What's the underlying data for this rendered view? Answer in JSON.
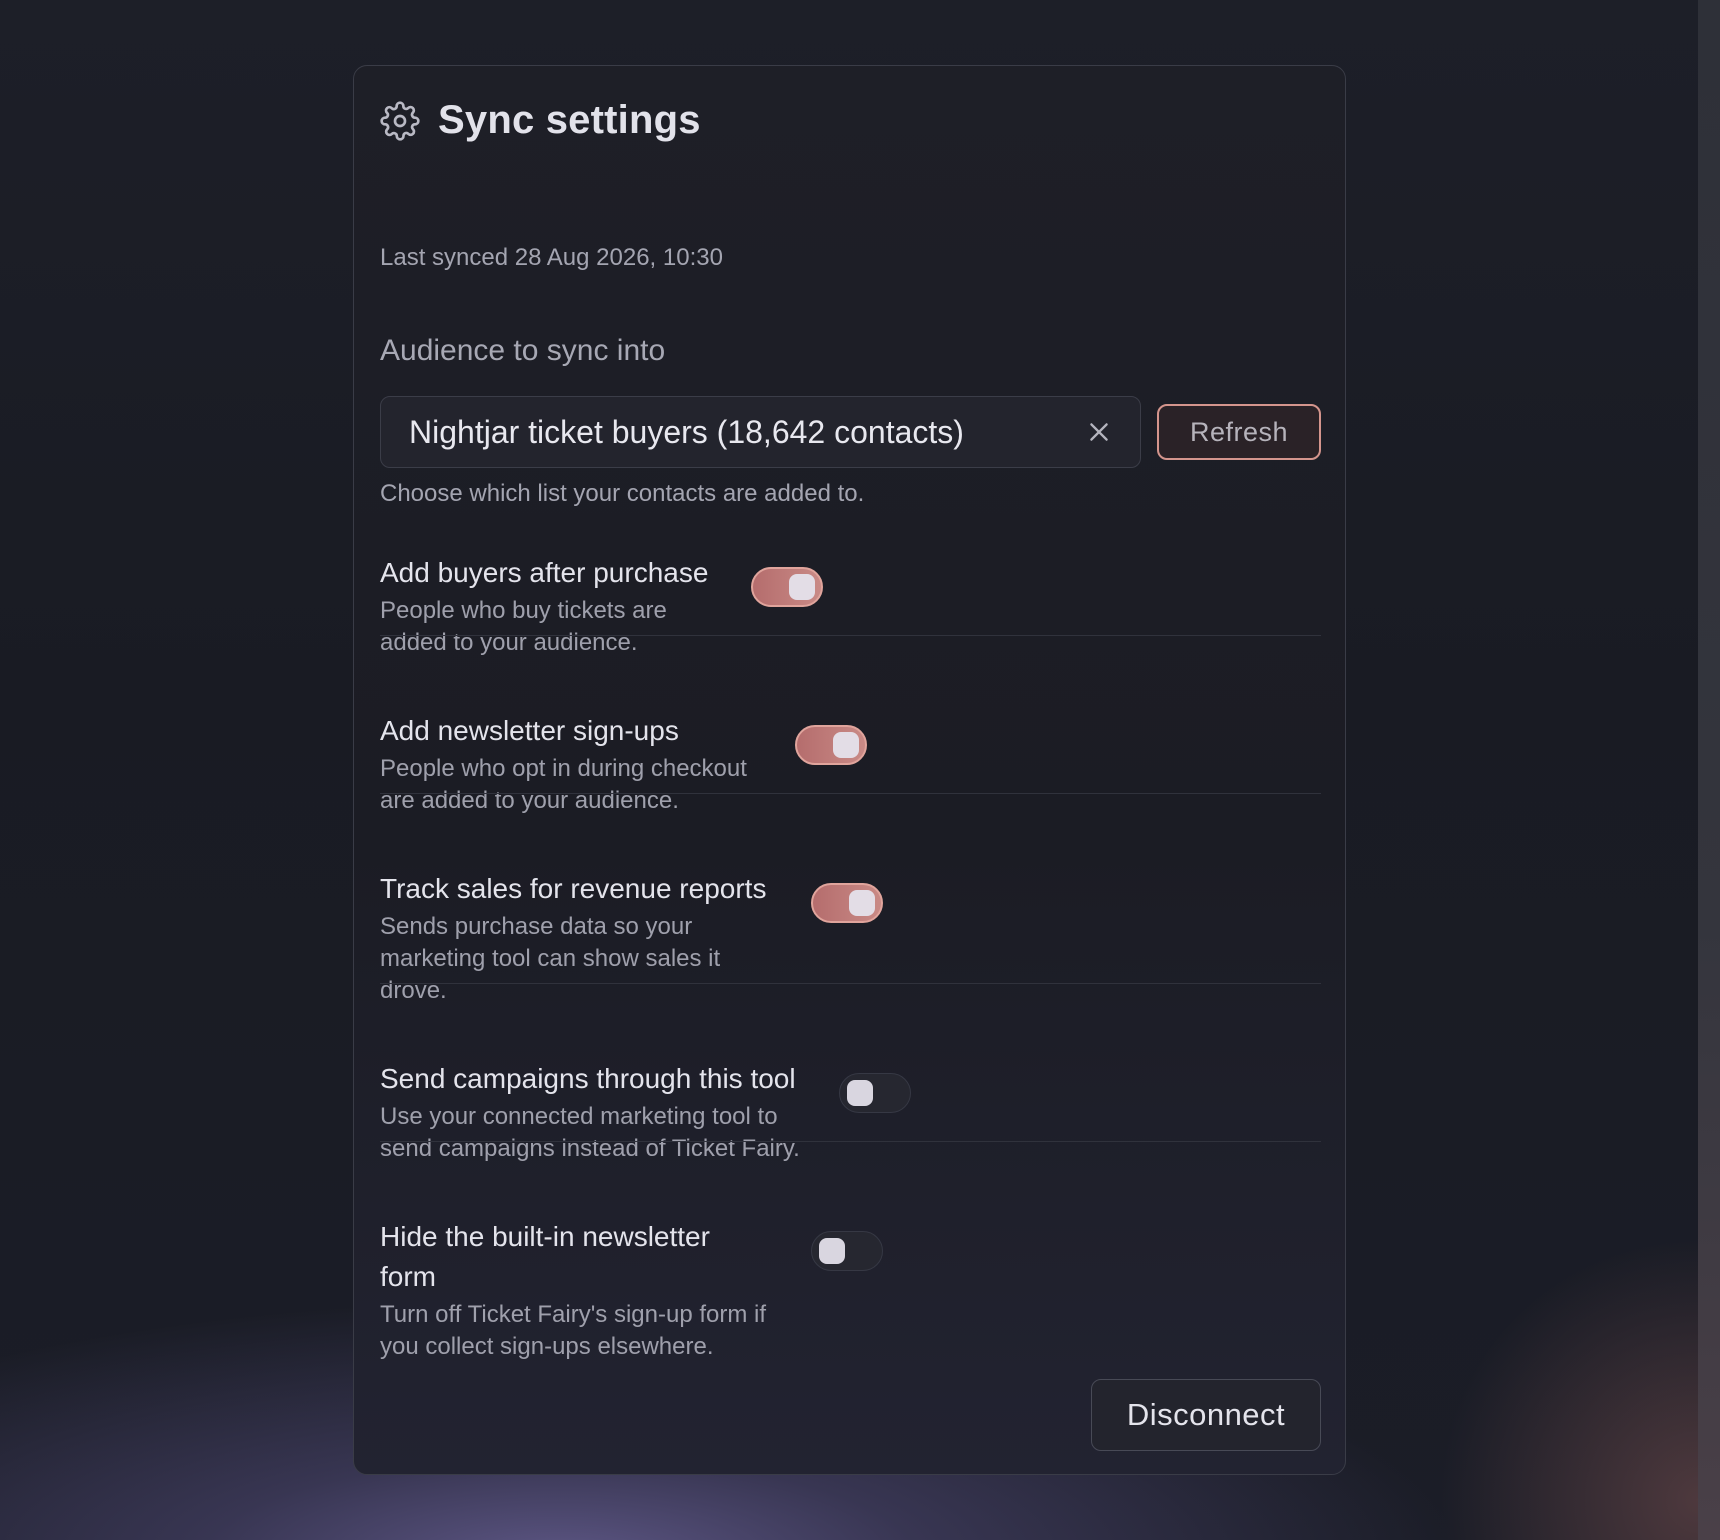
{
  "panel": {
    "title": "Sync settings",
    "last_synced": "Last synced 28 Aug 2026, 10:30",
    "audience_label": "Audience to sync into",
    "audience_value": "Nightjar ticket buyers (18,642 contacts)",
    "refresh_label": "Refresh",
    "helper": "Choose which list your contacts are added to.",
    "disconnect_label": "Disconnect"
  },
  "settings": [
    {
      "title": "Add buyers after purchase",
      "desc": [
        "People who buy tickets are",
        "added to your audience."
      ],
      "enabled": true
    },
    {
      "title": "Add newsletter sign-ups",
      "desc": [
        "People who opt in during checkout",
        "are added to your audience."
      ],
      "enabled": true
    },
    {
      "title": "Track sales for revenue reports",
      "desc": [
        "Sends purchase data so your",
        "marketing tool can show sales it",
        "drove."
      ],
      "enabled": true
    },
    {
      "title": "Send campaigns through this tool",
      "desc": [
        "Use your connected marketing tool to",
        "send campaigns instead of Ticket Fairy."
      ],
      "enabled": false
    },
    {
      "title": [
        "Hide the built-in newsletter",
        "form"
      ],
      "desc": [
        "Turn off Ticket Fairy's sign-up form if",
        "you collect sign-ups elsewhere."
      ],
      "enabled": false
    }
  ],
  "colors": {
    "accent": "#c98a86",
    "toggle_on_border": "#e0a49c",
    "background": "#1b1d25"
  },
  "icons": {
    "header": "gear-icon",
    "clear": "close-icon"
  }
}
